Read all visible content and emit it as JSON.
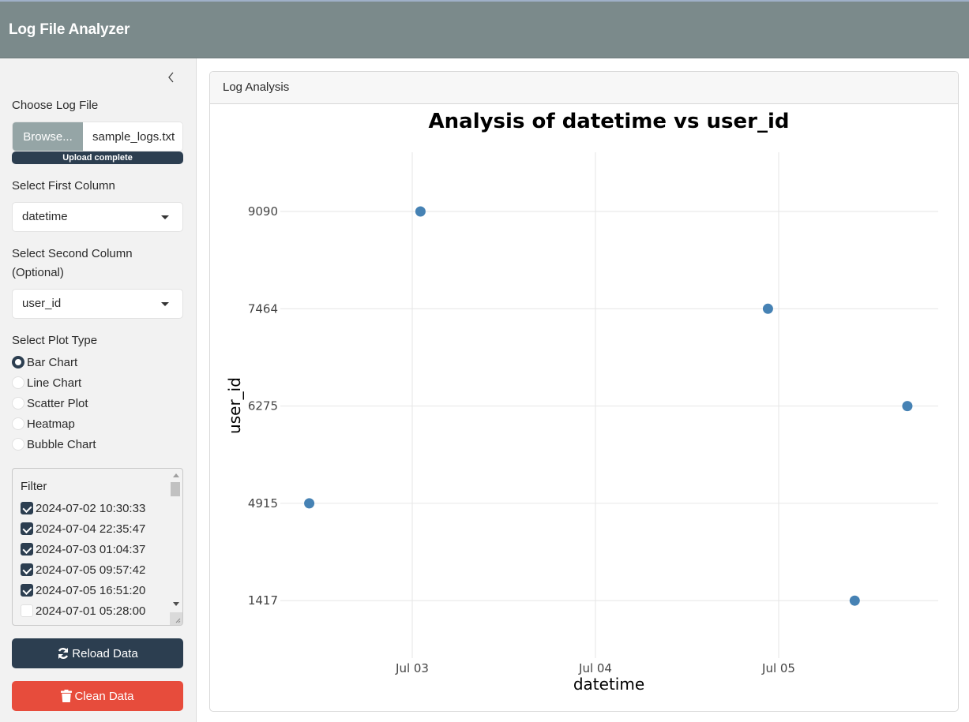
{
  "app": {
    "title": "Log File Analyzer"
  },
  "sidebar": {
    "file_input": {
      "label": "Choose Log File",
      "browse_label": "Browse...",
      "file_name": "sample_logs.txt",
      "progress_text": "Upload complete",
      "progress_fraction": 1.0
    },
    "first_column": {
      "label": "Select First Column",
      "value": "datetime"
    },
    "second_column": {
      "label": "Select Second Column (Optional)",
      "label_line1": "Select Second Column",
      "label_line2": "(Optional)",
      "value": "user_id"
    },
    "plot_type": {
      "label": "Select Plot Type",
      "options": [
        {
          "label": "Bar Chart",
          "checked": true
        },
        {
          "label": "Line Chart",
          "checked": false
        },
        {
          "label": "Scatter Plot",
          "checked": false
        },
        {
          "label": "Heatmap",
          "checked": false
        },
        {
          "label": "Bubble Chart",
          "checked": false
        }
      ]
    },
    "filter": {
      "title": "Filter",
      "items": [
        {
          "label": "2024-07-02 10:30:33",
          "checked": true
        },
        {
          "label": "2024-07-04 22:35:47",
          "checked": true
        },
        {
          "label": "2024-07-03 01:04:37",
          "checked": true
        },
        {
          "label": "2024-07-05 09:57:42",
          "checked": true
        },
        {
          "label": "2024-07-05 16:51:20",
          "checked": true
        },
        {
          "label": "2024-07-01 05:28:00",
          "checked": false
        }
      ]
    },
    "reload_label": "Reload Data",
    "clean_label": "Clean Data"
  },
  "main": {
    "card_title": "Log Analysis"
  },
  "colors": {
    "header_bg": "#7b8a8b",
    "primary": "#2c3e50",
    "danger": "#e74c3c",
    "browse": "#95a5a6",
    "point": "#4682b4"
  },
  "chart_data": {
    "type": "scatter",
    "title": "Analysis of datetime vs user_id",
    "xlabel": "datetime",
    "ylabel": "user_id",
    "x_type": "datetime",
    "y_type": "categorical",
    "x_ticks": [
      {
        "value": "2024-07-03 00:00:00",
        "label": "Jul 03"
      },
      {
        "value": "2024-07-04 00:00:00",
        "label": "Jul 04"
      },
      {
        "value": "2024-07-05 00:00:00",
        "label": "Jul 05"
      }
    ],
    "x_range": [
      "2024-07-02 05:00:00",
      "2024-07-05 21:00:00"
    ],
    "y_categories": [
      "1417",
      "4915",
      "6275",
      "7464",
      "9090"
    ],
    "grid": true,
    "legend": "none",
    "points": [
      {
        "x": "2024-07-02 10:30:33",
        "y": "4915"
      },
      {
        "x": "2024-07-03 01:04:37",
        "y": "9090"
      },
      {
        "x": "2024-07-04 22:35:47",
        "y": "7464"
      },
      {
        "x": "2024-07-05 09:57:42",
        "y": "1417"
      },
      {
        "x": "2024-07-05 16:51:20",
        "y": "6275"
      }
    ]
  }
}
